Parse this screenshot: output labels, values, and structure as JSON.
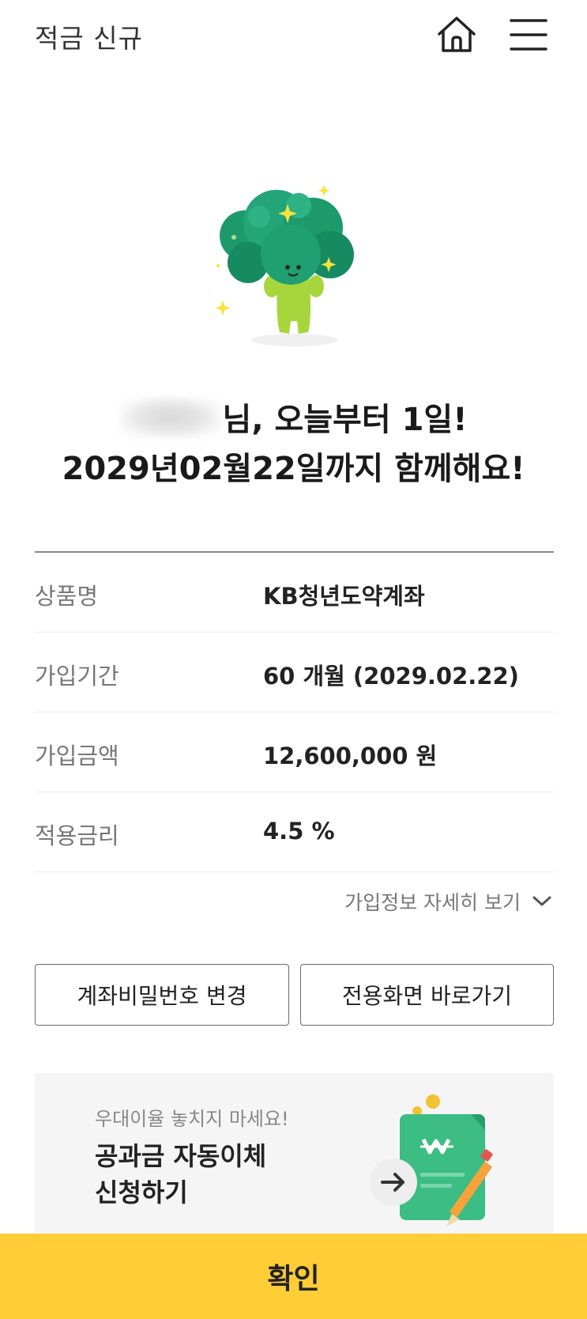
{
  "header": {
    "title": "적금 신규"
  },
  "headline": {
    "line1_suffix": "님, 오늘부터 1일!",
    "line2": "2029년02월22일까지 함께해요!"
  },
  "info_rows": [
    {
      "label": "상품명",
      "value": "KB청년도약계좌"
    },
    {
      "label": "가입기간",
      "value": "60 개월 (2029.02.22)"
    },
    {
      "label": "가입금액",
      "value": "12,600,000 원"
    },
    {
      "label": "적용금리",
      "value": "4.5 %"
    }
  ],
  "detail_link": "가입정보 자세히 보기",
  "buttons": {
    "change_password": "계좌비밀번호 변경",
    "go_dedicated": "전용화면 바로가기"
  },
  "banner": {
    "subtitle": "우대이율 놓치지 마세요!",
    "title_line1": "공과금 자동이체",
    "title_line2": "신청하기"
  },
  "confirm_label": "확인",
  "colors": {
    "accent": "#ffcd36",
    "mascot_green": "#1f9b6e",
    "mascot_stem": "#a6d63c"
  }
}
